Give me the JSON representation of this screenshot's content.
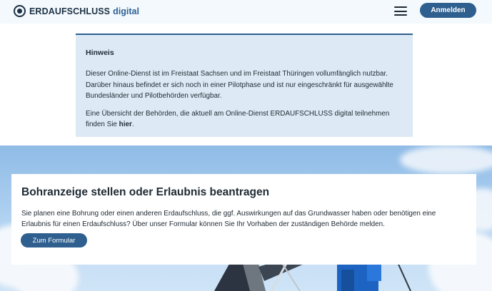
{
  "header": {
    "logo_text": "ERDAUFSCHLUSS",
    "logo_suffix": "digital",
    "login_label": "Anmelden"
  },
  "notice": {
    "title": "Hinweis",
    "paragraph1": "Dieser Online-Dienst ist im Freistaat Sachsen und im Freistaat Thüringen vollumfänglich nutzbar. Darüber hinaus befindet er sich noch in einer Pilotphase und ist nur eingeschränkt für ausgewählte Bundesländer und Pilotbehörden verfügbar.",
    "paragraph2_prefix": "Eine Übersicht der Behörden, die aktuell am Online-Dienst ERDAUFSCHLUSS digital teilnehmen finden Sie ",
    "paragraph2_link": "hier",
    "paragraph2_suffix": "."
  },
  "card": {
    "title": "Bohranzeige stellen oder Erlaubnis beantragen",
    "text": "Sie planen eine Bohrung oder einen anderen Erdaufschluss, die ggf. Auswirkungen auf das Grundwasser haben oder benötigen eine Erlaubnis für einen Erdaufschluss? Über unser Formular können Sie Ihr Vorhaben der zuständigen Behörde melden.",
    "button_label": "Zum Formular"
  },
  "colors": {
    "accent": "#2e5f8f",
    "notice_bg": "#dde9f4",
    "header_bg": "#f3f9fd"
  }
}
